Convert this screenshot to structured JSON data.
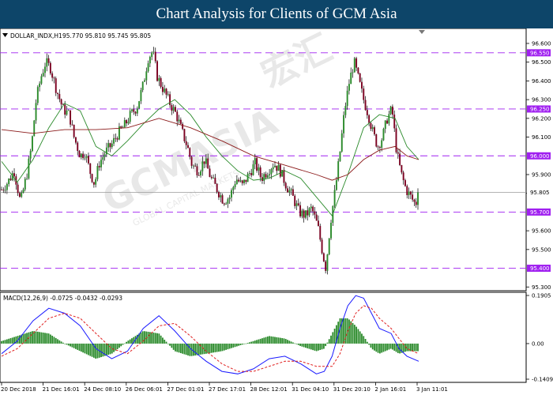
{
  "page_title": "Chart Analysis for Clients of GCM Asia",
  "watermark": {
    "main": "GCMASIA",
    "brand": "GCMASIA",
    "chinese": "宏汇",
    "sub": "GLOBAL CAPITAL MARKETS"
  },
  "chart_data": [
    {
      "type": "candlestick",
      "instrument_label": "DOLLAR_INDX,H1",
      "ohlc_label": "95.770 95.810 95.745 95.805",
      "current_price": 95.805,
      "ylim": [
        95.28,
        96.68
      ],
      "y_ticks": [
        "96.600",
        "96.500",
        "96.400",
        "96.300",
        "96.200",
        "96.100",
        "95.900",
        "95.800",
        "95.600",
        "95.500",
        "95.300"
      ],
      "x_ticks": [
        "20 Dec 2018",
        "21 Dec 16:01",
        "24 Dec 08:10",
        "26 Dec 06:01",
        "27 Dec 01:01",
        "27 Dec 17:01",
        "28 Dec 12:01",
        "31 Dec 04:10",
        "31 Dec 20:10",
        "2 Jan 16:01",
        "3 Jan 11:01"
      ],
      "levels": [
        {
          "value": 96.55,
          "label": "96.550"
        },
        {
          "value": 96.25,
          "label": "96.250"
        },
        {
          "value": 96.0,
          "label": "96.000"
        },
        {
          "value": 95.7,
          "label": "95.700"
        },
        {
          "value": 95.4,
          "label": "95.400"
        }
      ],
      "price_path": [
        [
          0,
          95.82
        ],
        [
          8,
          95.86
        ],
        [
          16,
          95.92
        ],
        [
          24,
          95.75
        ],
        [
          32,
          95.9
        ],
        [
          38,
          96.05
        ],
        [
          44,
          96.3
        ],
        [
          50,
          96.42
        ],
        [
          56,
          96.5
        ],
        [
          62,
          96.47
        ],
        [
          70,
          96.35
        ],
        [
          78,
          96.25
        ],
        [
          86,
          96.22
        ],
        [
          92,
          96.1
        ],
        [
          100,
          96.0
        ],
        [
          106,
          96.02
        ],
        [
          112,
          95.92
        ],
        [
          118,
          95.85
        ],
        [
          124,
          95.96
        ],
        [
          132,
          96.02
        ],
        [
          140,
          96.06
        ],
        [
          148,
          96.12
        ],
        [
          156,
          96.16
        ],
        [
          164,
          96.22
        ],
        [
          172,
          96.26
        ],
        [
          180,
          96.38
        ],
        [
          186,
          96.52
        ],
        [
          192,
          96.56
        ],
        [
          198,
          96.42
        ],
        [
          206,
          96.35
        ],
        [
          214,
          96.28
        ],
        [
          222,
          96.22
        ],
        [
          230,
          96.12
        ],
        [
          236,
          96.05
        ],
        [
          242,
          95.95
        ],
        [
          250,
          95.92
        ],
        [
          258,
          95.98
        ],
        [
          266,
          95.88
        ],
        [
          274,
          95.82
        ],
        [
          282,
          95.76
        ],
        [
          290,
          95.78
        ],
        [
          298,
          95.88
        ],
        [
          306,
          95.84
        ],
        [
          314,
          95.9
        ],
        [
          322,
          95.96
        ],
        [
          330,
          95.88
        ],
        [
          338,
          95.92
        ],
        [
          346,
          95.96
        ],
        [
          354,
          95.92
        ],
        [
          362,
          95.84
        ],
        [
          370,
          95.78
        ],
        [
          378,
          95.7
        ],
        [
          386,
          95.68
        ],
        [
          394,
          95.72
        ],
        [
          402,
          95.62
        ],
        [
          408,
          95.48
        ],
        [
          412,
          95.4
        ],
        [
          418,
          95.65
        ],
        [
          424,
          95.82
        ],
        [
          430,
          96.02
        ],
        [
          436,
          96.25
        ],
        [
          442,
          96.4
        ],
        [
          448,
          96.5
        ],
        [
          454,
          96.4
        ],
        [
          460,
          96.3
        ],
        [
          466,
          96.22
        ],
        [
          472,
          96.12
        ],
        [
          478,
          96.05
        ],
        [
          484,
          96.1
        ],
        [
          490,
          96.2
        ],
        [
          496,
          96.25
        ],
        [
          502,
          96.02
        ],
        [
          508,
          95.9
        ],
        [
          514,
          95.82
        ],
        [
          520,
          95.78
        ],
        [
          526,
          95.74
        ],
        [
          530,
          95.8
        ]
      ],
      "moving_averages": [
        {
          "color": "#2a8a2a",
          "values": [
            [
              0,
              95.97
            ],
            [
              20,
              95.86
            ],
            [
              40,
              95.98
            ],
            [
              60,
              96.15
            ],
            [
              80,
              96.28
            ],
            [
              100,
              96.24
            ],
            [
              120,
              96.05
            ],
            [
              140,
              96.0
            ],
            [
              160,
              96.08
            ],
            [
              180,
              96.17
            ],
            [
              200,
              96.25
            ],
            [
              220,
              96.3
            ],
            [
              240,
              96.22
            ],
            [
              260,
              96.1
            ],
            [
              280,
              96.0
            ],
            [
              300,
              95.92
            ],
            [
              320,
              95.87
            ],
            [
              340,
              95.88
            ],
            [
              360,
              95.92
            ],
            [
              380,
              95.88
            ],
            [
              400,
              95.78
            ],
            [
              420,
              95.68
            ],
            [
              440,
              95.9
            ],
            [
              460,
              96.15
            ],
            [
              480,
              96.22
            ],
            [
              500,
              96.2
            ],
            [
              515,
              96.05
            ],
            [
              530,
              95.98
            ]
          ]
        },
        {
          "color": "#8b1a1a",
          "values": [
            [
              0,
              96.14
            ],
            [
              40,
              96.12
            ],
            [
              80,
              96.14
            ],
            [
              120,
              96.14
            ],
            [
              160,
              96.15
            ],
            [
              200,
              96.2
            ],
            [
              240,
              96.15
            ],
            [
              280,
              96.08
            ],
            [
              320,
              96.0
            ],
            [
              360,
              95.95
            ],
            [
              400,
              95.9
            ],
            [
              420,
              95.87
            ],
            [
              440,
              95.9
            ],
            [
              460,
              95.98
            ],
            [
              480,
              96.03
            ],
            [
              500,
              96.05
            ],
            [
              515,
              96.0
            ],
            [
              530,
              95.98
            ]
          ]
        }
      ]
    },
    {
      "type": "macd",
      "title": "MACD(12,26,9) -0.0725 -0.0432 -0.0293",
      "ylim": [
        -0.1409,
        0.1905
      ],
      "y_ticks": [
        "0.1905",
        "0.00",
        "-0.1409"
      ],
      "macd_line": [
        [
          0,
          -0.04
        ],
        [
          20,
          0.01
        ],
        [
          40,
          0.09
        ],
        [
          60,
          0.14
        ],
        [
          80,
          0.12
        ],
        [
          100,
          0.07
        ],
        [
          120,
          -0.02
        ],
        [
          140,
          -0.06
        ],
        [
          160,
          -0.03
        ],
        [
          180,
          0.06
        ],
        [
          200,
          0.11
        ],
        [
          220,
          0.05
        ],
        [
          240,
          -0.02
        ],
        [
          260,
          -0.07
        ],
        [
          280,
          -0.11
        ],
        [
          300,
          -0.12
        ],
        [
          320,
          -0.1
        ],
        [
          340,
          -0.06
        ],
        [
          360,
          -0.05
        ],
        [
          380,
          -0.08
        ],
        [
          400,
          -0.12
        ],
        [
          410,
          -0.11
        ],
        [
          420,
          -0.05
        ],
        [
          430,
          0.06
        ],
        [
          440,
          0.15
        ],
        [
          450,
          0.19
        ],
        [
          460,
          0.18
        ],
        [
          470,
          0.12
        ],
        [
          480,
          0.06
        ],
        [
          495,
          0.04
        ],
        [
          505,
          -0.02
        ],
        [
          515,
          -0.05
        ],
        [
          530,
          -0.07
        ]
      ],
      "signal_line": [
        [
          0,
          -0.05
        ],
        [
          20,
          -0.02
        ],
        [
          40,
          0.04
        ],
        [
          60,
          0.1
        ],
        [
          80,
          0.12
        ],
        [
          100,
          0.1
        ],
        [
          120,
          0.04
        ],
        [
          140,
          -0.02
        ],
        [
          160,
          -0.04
        ],
        [
          180,
          0.01
        ],
        [
          200,
          0.07
        ],
        [
          220,
          0.08
        ],
        [
          240,
          0.03
        ],
        [
          260,
          -0.03
        ],
        [
          280,
          -0.08
        ],
        [
          300,
          -0.11
        ],
        [
          320,
          -0.11
        ],
        [
          340,
          -0.09
        ],
        [
          360,
          -0.07
        ],
        [
          380,
          -0.07
        ],
        [
          400,
          -0.09
        ],
        [
          420,
          -0.09
        ],
        [
          430,
          -0.04
        ],
        [
          440,
          0.05
        ],
        [
          450,
          0.12
        ],
        [
          460,
          0.15
        ],
        [
          470,
          0.14
        ],
        [
          480,
          0.1
        ],
        [
          495,
          0.06
        ],
        [
          505,
          0.02
        ],
        [
          515,
          -0.02
        ],
        [
          530,
          -0.04
        ]
      ],
      "histogram": [
        [
          0,
          0.01
        ],
        [
          20,
          0.03
        ],
        [
          40,
          0.05
        ],
        [
          60,
          0.04
        ],
        [
          80,
          0.0
        ],
        [
          100,
          -0.03
        ],
        [
          120,
          -0.06
        ],
        [
          140,
          -0.04
        ],
        [
          160,
          0.01
        ],
        [
          180,
          0.05
        ],
        [
          200,
          0.04
        ],
        [
          220,
          -0.03
        ],
        [
          240,
          -0.05
        ],
        [
          260,
          -0.04
        ],
        [
          280,
          -0.03
        ],
        [
          300,
          -0.01
        ],
        [
          320,
          0.01
        ],
        [
          340,
          0.03
        ],
        [
          360,
          0.02
        ],
        [
          380,
          -0.01
        ],
        [
          400,
          -0.03
        ],
        [
          410,
          -0.02
        ],
        [
          420,
          0.04
        ],
        [
          430,
          0.1
        ],
        [
          440,
          0.1
        ],
        [
          450,
          0.07
        ],
        [
          460,
          0.03
        ],
        [
          470,
          -0.02
        ],
        [
          480,
          -0.04
        ],
        [
          495,
          -0.02
        ],
        [
          505,
          -0.04
        ],
        [
          515,
          -0.03
        ],
        [
          530,
          -0.03
        ]
      ]
    }
  ]
}
